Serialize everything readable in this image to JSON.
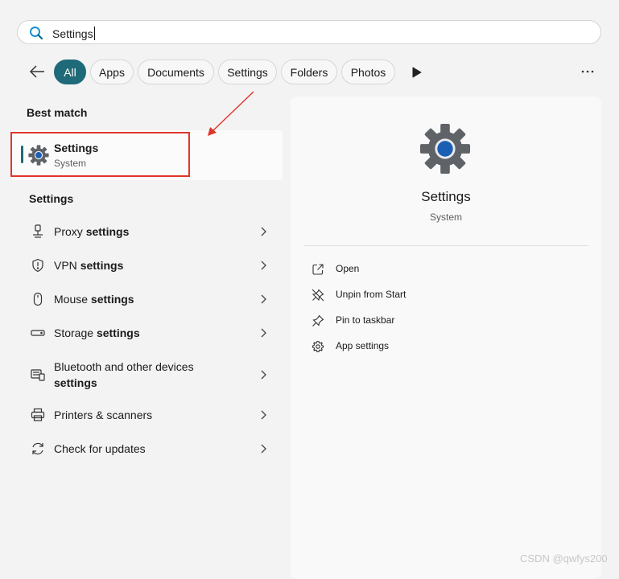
{
  "search": {
    "value": "Settings",
    "icon": "search-icon"
  },
  "filters": {
    "back_icon": "back-arrow-icon",
    "chips": [
      {
        "label": "All",
        "active": true
      },
      {
        "label": "Apps"
      },
      {
        "label": "Documents"
      },
      {
        "label": "Settings"
      },
      {
        "label": "Folders"
      },
      {
        "label": "Photos"
      }
    ],
    "more_icon": "more-options-icon"
  },
  "best_match": {
    "heading": "Best match",
    "title": "Settings",
    "subtitle": "System"
  },
  "settings_section": {
    "heading": "Settings",
    "items": [
      {
        "text": "Proxy ",
        "bold": "settings",
        "icon": "proxy-icon"
      },
      {
        "text": "VPN ",
        "bold": "settings",
        "icon": "shield-icon"
      },
      {
        "text": "Mouse ",
        "bold": "settings",
        "icon": "mouse-icon"
      },
      {
        "text": "Storage ",
        "bold": "settings",
        "icon": "storage-icon"
      },
      {
        "text": "Bluetooth and other devices",
        "bold": "settings",
        "icon": "devices-icon"
      },
      {
        "text": "Printers & scanners",
        "bold": "",
        "icon": "printer-icon"
      },
      {
        "text": "Check for updates",
        "bold": "",
        "icon": "refresh-icon"
      }
    ]
  },
  "detail": {
    "title": "Settings",
    "subtitle": "System",
    "actions": [
      {
        "label": "Open",
        "icon": "open-icon"
      },
      {
        "label": "Unpin from Start",
        "icon": "unpin-icon"
      },
      {
        "label": "Pin to taskbar",
        "icon": "pin-icon"
      },
      {
        "label": "App settings",
        "icon": "gear-icon"
      }
    ]
  },
  "watermark": "CSDN @qwfys200",
  "colors": {
    "accent": "#1f6a78",
    "highlight": "#e0352b",
    "gear": "#5f6368",
    "gear_center": "#1a5fb4"
  }
}
